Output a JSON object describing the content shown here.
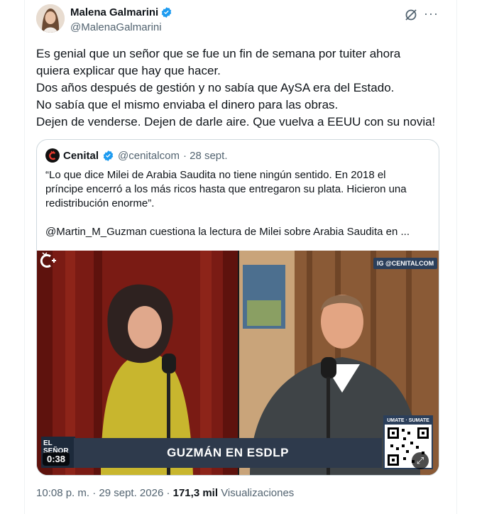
{
  "author": {
    "name": "Malena Galmarini",
    "handle": "@MalenaGalmarini",
    "verified_icon": "verified-badge-icon"
  },
  "actions": {
    "grok_icon": "grok-icon",
    "more_icon": "more-icon",
    "more_label": "···"
  },
  "tweet": {
    "lines": [
      "Es genial que un señor que se fue un fin de semana por tuiter ahora",
      "quiera explicar que hay que hacer.",
      "Dos años después de gestión y no sabía que AySA era del Estado.",
      "No sabía que el mismo enviaba el dinero para las obras.",
      "Dejen de venderse. Dejen de darle aire. Que vuelva a EEUU con su novia!"
    ]
  },
  "quote": {
    "name": "Cenital",
    "handle": "@cenitalcom",
    "date": "· 28 sept.",
    "lines": [
      "“Lo que dice Milei de Arabia Saudita no tiene ningún sentido. En 2018 el",
      "príncipe encerró a los más ricos hasta que entregaron su plata. Hicieron una",
      "redistribución enorme”.",
      "",
      "@Martin_M_Guzman cuestiona la lectura de Milei sobre Arabia Saudita en ..."
    ],
    "video": {
      "title": "GUZMÁN EN ESDLP",
      "show_label_1": "EL",
      "show_label_2": "SEÑOR",
      "duration": "0:38",
      "ig_tag": "IG @CENITALCOM",
      "sumate": "UMATE · SUMATE",
      "expand_icon": "expand-icon"
    }
  },
  "footer": {
    "time": "10:08 p. m. · 29 sept. 2026 ·",
    "views_count": "171,3 mil",
    "views_label": "Visualizaciones"
  },
  "colors": {
    "verified": "#1d9bf0",
    "secondary_text": "#536471",
    "border": "#cfd9de"
  }
}
